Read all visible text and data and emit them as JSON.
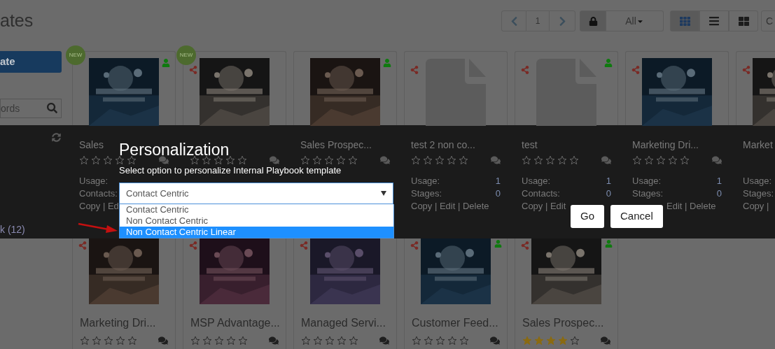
{
  "page_title": "ates",
  "toolbar": {
    "page": "1",
    "filter": "All",
    "lock_selected": true,
    "views": [
      {
        "kind": "grid",
        "selected": true
      },
      {
        "kind": "list",
        "selected": false
      },
      {
        "kind": "tiles",
        "selected": false
      }
    ],
    "cut_button": "C"
  },
  "sidebar": {
    "create_button": "ate",
    "search": {
      "placeholder": "ords"
    },
    "footer_text": "k (12)"
  },
  "cards_row1": [
    {
      "badge": "NEW",
      "shared": false,
      "personal": true,
      "kind": "picture",
      "title": "Sales",
      "stars": 0,
      "chat": true,
      "stats": [
        {
          "label": "Usage:"
        },
        {
          "label": "Contacts:"
        }
      ],
      "links": "Copy | Ed",
      "links_offset": false
    },
    {
      "badge": "NEW",
      "shared": true,
      "personal": false,
      "kind": "picture",
      "stars": 0,
      "chat": true
    },
    {
      "shared": false,
      "personal": true,
      "kind": "picture",
      "title": "Sales Prospec...",
      "stars": 0,
      "chat": true
    },
    {
      "shared": true,
      "personal": false,
      "kind": "document",
      "title": "test 2 non co...",
      "stars": 0,
      "chat": true,
      "stats": [
        {
          "label": "Usage:",
          "value": "1"
        },
        {
          "label": "Stages:",
          "value": "0"
        }
      ],
      "links": "Copy | Edit | Delete",
      "links_offset": false
    },
    {
      "shared": true,
      "personal": true,
      "kind": "document",
      "title": "test",
      "stars": 0,
      "chat": true,
      "stats": [
        {
          "label": "Usage:",
          "value": "1"
        },
        {
          "label": "Contacts:",
          "value": "0"
        }
      ],
      "links": "Copy | Edit",
      "links_offset": false
    },
    {
      "shared": true,
      "personal": false,
      "kind": "picture",
      "title": "Marketing Dri...",
      "stars": 0,
      "chat": true,
      "stats": [
        {
          "label": "Usage:",
          "value": "1"
        },
        {
          "label": "Stages:",
          "value": "0"
        }
      ],
      "links": "Edit | Delete",
      "links_offset": true
    },
    {
      "shared": true,
      "personal": false,
      "kind": "picture",
      "title": "Market",
      "chat": false,
      "stats": [
        {
          "label": "Usage:"
        },
        {
          "label": "Stages:"
        }
      ],
      "links": "Copy |",
      "links_offset": false
    }
  ],
  "cards_row2": [
    {
      "shared": true,
      "personal": false,
      "title": "Marketing Dri...",
      "stars": 0
    },
    {
      "shared": true,
      "personal": false,
      "title": "MSP Advantage...",
      "stars": 0
    },
    {
      "shared": true,
      "personal": false,
      "title": "Managed Servi...",
      "stars": 0
    },
    {
      "shared": true,
      "personal": true,
      "title": "Customer Feed...",
      "stars": 0
    },
    {
      "shared": true,
      "personal": true,
      "title": "Sales Prospec...",
      "stars": 4
    }
  ],
  "modal": {
    "title": "Personalization",
    "subtitle": "Select option to personalize Internal Playbook template",
    "select_value": "Contact Centric",
    "options": [
      {
        "label": "Contact Centric",
        "selected": false
      },
      {
        "label": "Non Contact Centric",
        "selected": false
      },
      {
        "label": "Non Contact Centric Linear",
        "selected": true
      }
    ],
    "buttons": [
      "Go",
      "Cancel"
    ]
  }
}
